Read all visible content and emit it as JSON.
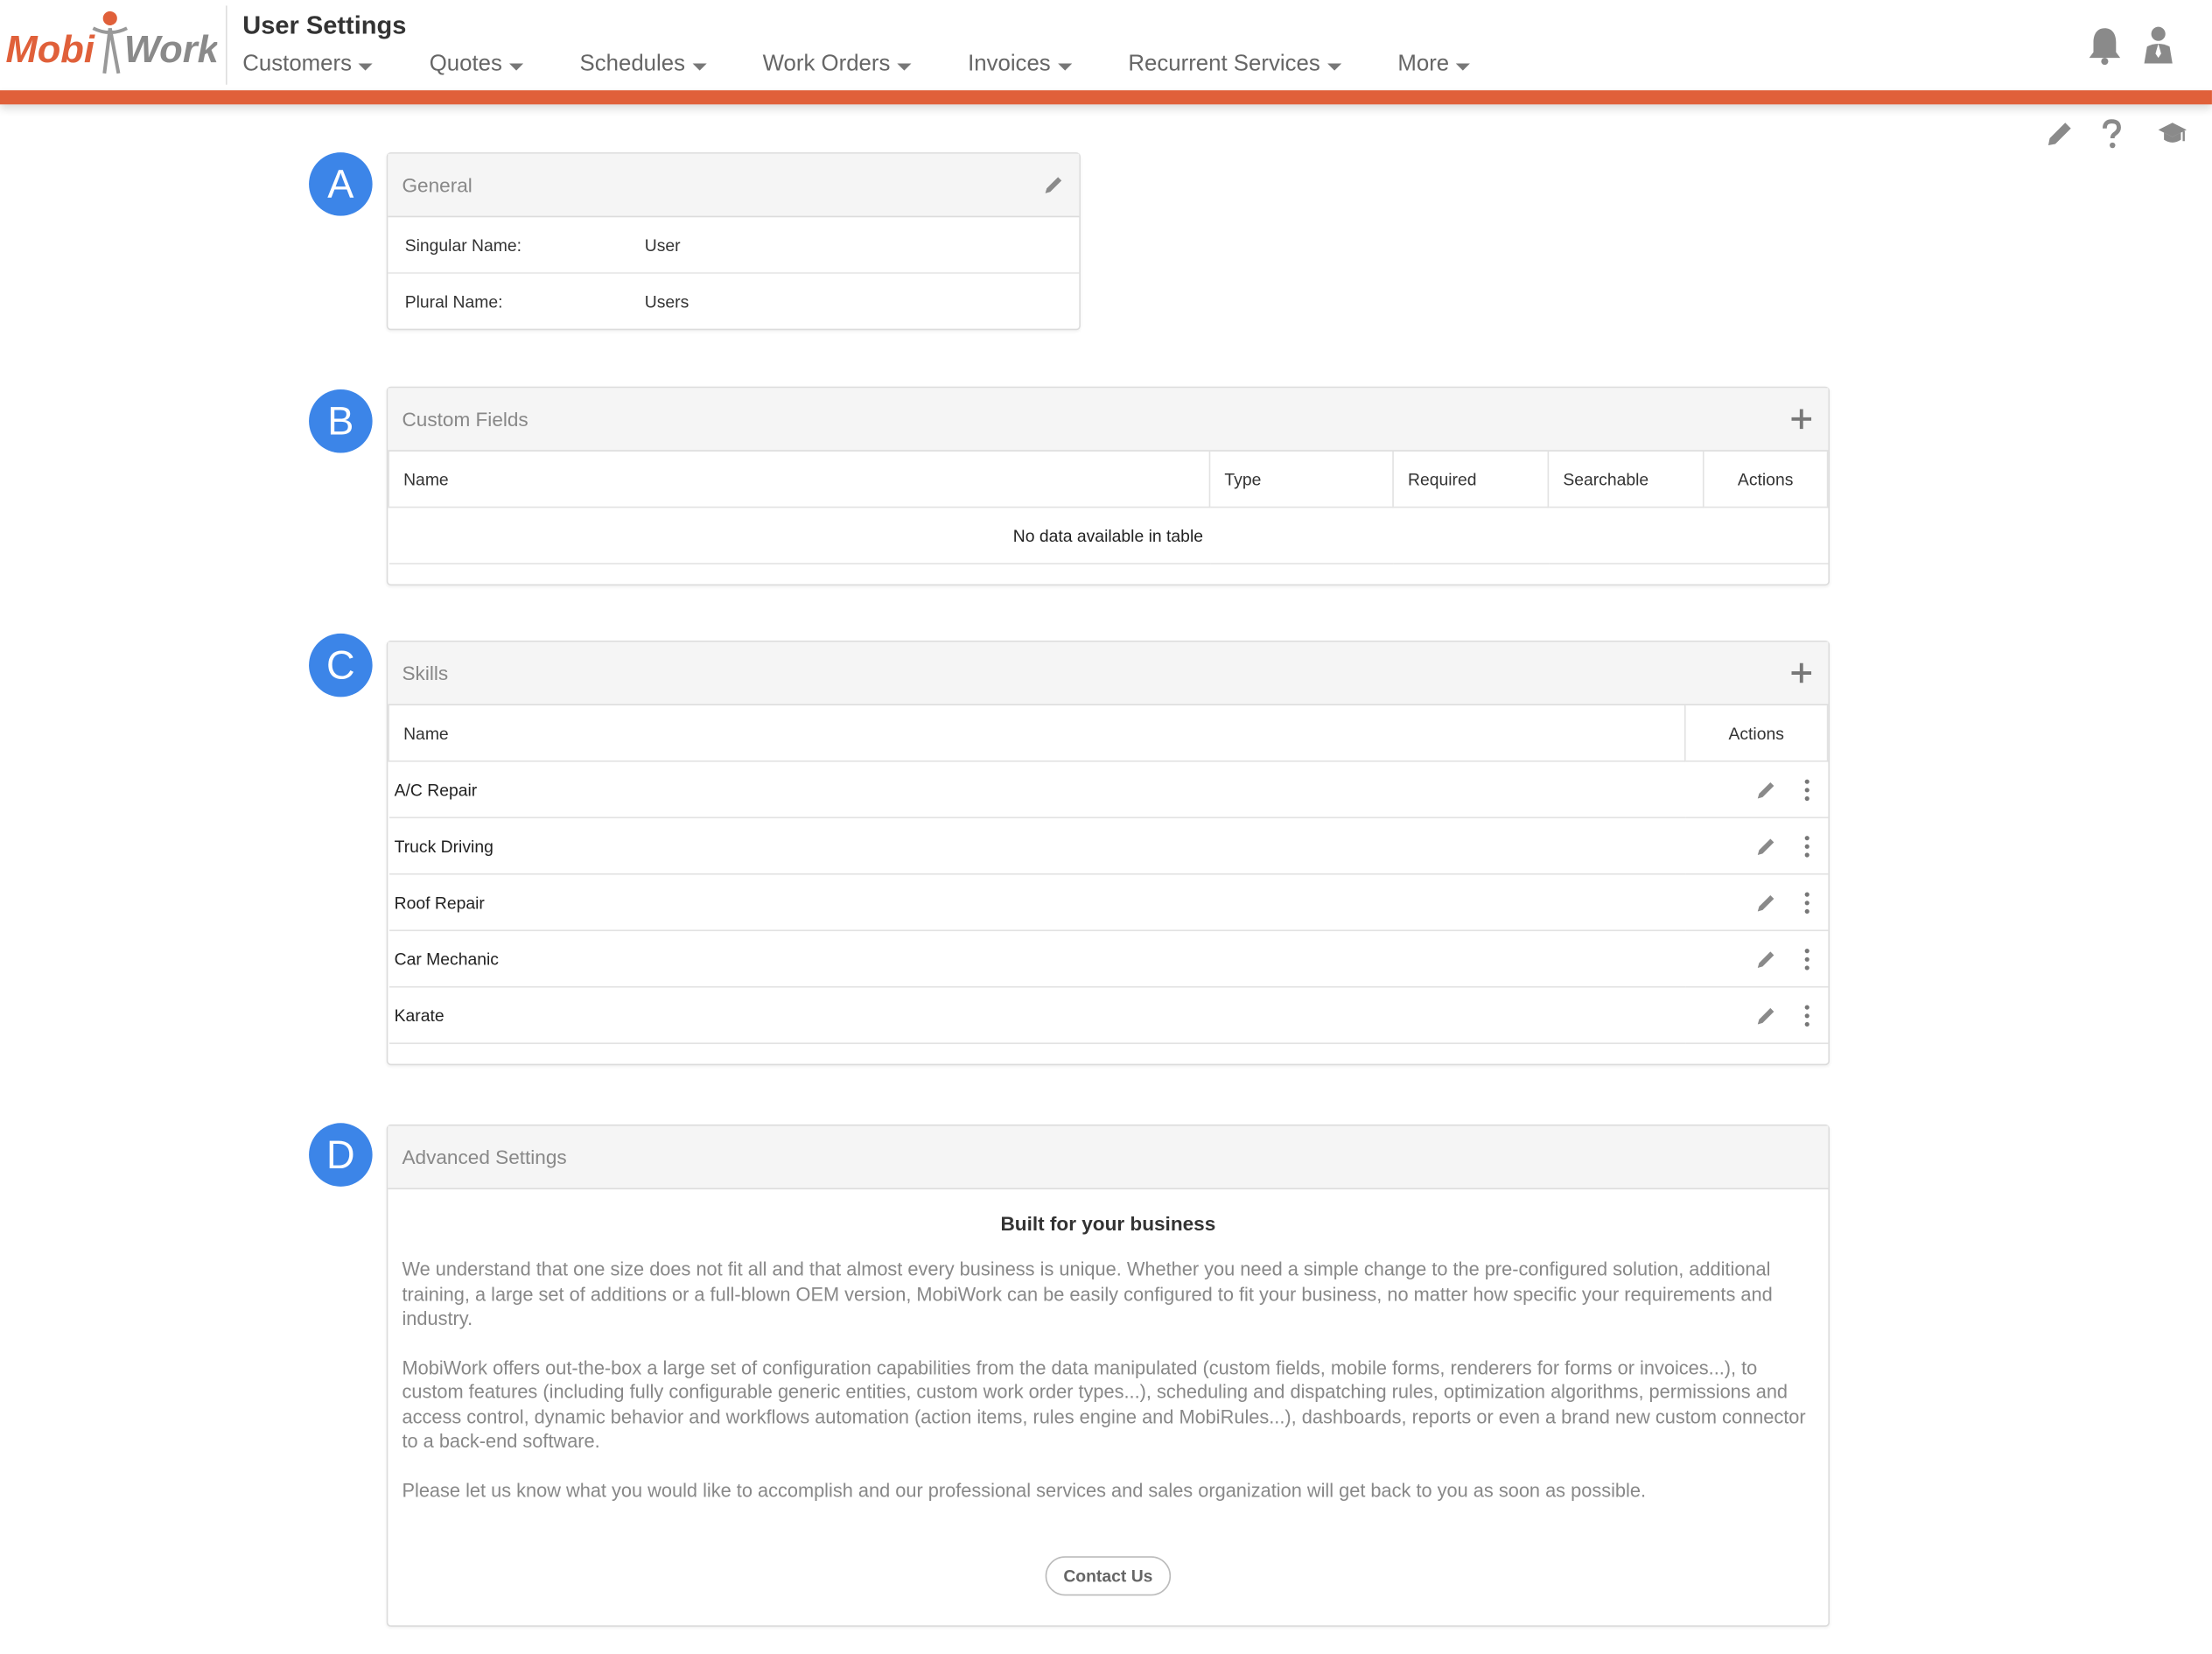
{
  "header": {
    "brand": {
      "left": "Mobi",
      "right": "Work"
    },
    "title": "User Settings",
    "nav": [
      "Customers",
      "Quotes",
      "Schedules",
      "Work Orders",
      "Invoices",
      "Recurrent Services",
      "More"
    ],
    "accent_color": "#e0603a"
  },
  "badges": [
    "A",
    "B",
    "C",
    "D"
  ],
  "general": {
    "title": "General",
    "rows": [
      {
        "label": "Singular Name:",
        "value": "User"
      },
      {
        "label": "Plural Name:",
        "value": "Users"
      }
    ]
  },
  "custom_fields": {
    "title": "Custom Fields",
    "columns": [
      "Name",
      "Type",
      "Required",
      "Searchable",
      "Actions"
    ],
    "empty_text": "No data available in table"
  },
  "skills": {
    "title": "Skills",
    "columns": [
      "Name",
      "Actions"
    ],
    "rows": [
      "A/C Repair",
      "Truck Driving",
      "Roof Repair",
      "Car Mechanic",
      "Karate"
    ]
  },
  "advanced": {
    "title": "Advanced Settings",
    "heading": "Built for your business",
    "paragraphs": [
      "We understand that one size does not fit all and that almost every business is unique. Whether you need a simple change to the pre-configured solution, additional training, a large set of additions or a full-blown OEM version, MobiWork can be easily configured to fit your business, no matter how specific your requirements and industry.",
      "MobiWork offers out-the-box a large set of configuration capabilities from the data manipulated (custom fields, mobile forms, renderers for forms or invoices...), to custom features (including fully configurable generic entities, custom work order types...), scheduling and dispatching rules, optimization algorithms, permissions and access control, dynamic behavior and workflows automation (action items, rules engine and MobiRules...), dashboards, reports or even a brand new custom connector to a back-end software.",
      "Please let us know what you would like to accomplish and our professional services and sales organization will get back to you as soon as possible."
    ],
    "contact_label": "Contact Us"
  },
  "colors": {
    "badge": "#3c85e8",
    "icon_gray": "#888888"
  }
}
